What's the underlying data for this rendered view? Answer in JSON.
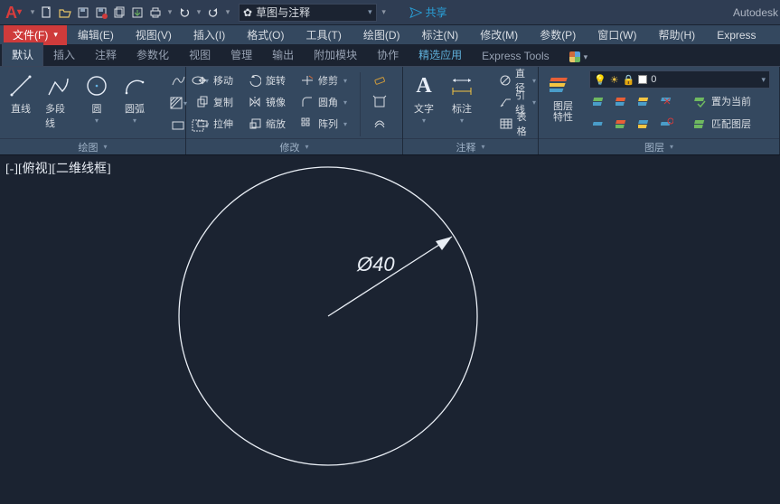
{
  "titlebar": {
    "workspace": "草图与注释",
    "search_placeholder": "▾",
    "share": "共享",
    "brand": "Autodesk"
  },
  "menus": [
    "文件(F)",
    "编辑(E)",
    "视图(V)",
    "插入(I)",
    "格式(O)",
    "工具(T)",
    "绘图(D)",
    "标注(N)",
    "修改(M)",
    "参数(P)",
    "窗口(W)",
    "帮助(H)",
    "Express"
  ],
  "ribbon_tabs": [
    "默认",
    "插入",
    "注释",
    "参数化",
    "视图",
    "管理",
    "输出",
    "附加模块",
    "协作",
    "精选应用",
    "Express Tools"
  ],
  "draw": {
    "line": "直线",
    "pline": "多段线",
    "circle": "圆",
    "arc": "圆弧",
    "panel": "绘图"
  },
  "modify": {
    "move": "移动",
    "rotate": "旋转",
    "trim": "修剪",
    "copy": "复制",
    "mirror": "镜像",
    "fillet": "圆角",
    "stretch": "拉伸",
    "scale": "缩放",
    "array": "阵列",
    "panel": "修改"
  },
  "annotate": {
    "text": "文字",
    "dim": "标注",
    "diameter": "直径",
    "leader": "引线",
    "table": "表格",
    "panel": "注释"
  },
  "layer": {
    "props": "图层\n特性",
    "current": "0",
    "set_current": "置为当前",
    "match": "匹配图层",
    "panel": "图层"
  },
  "viewport_label": "[-][俯视][二维线框]",
  "drawing": {
    "diameter_label": "Ø40"
  }
}
